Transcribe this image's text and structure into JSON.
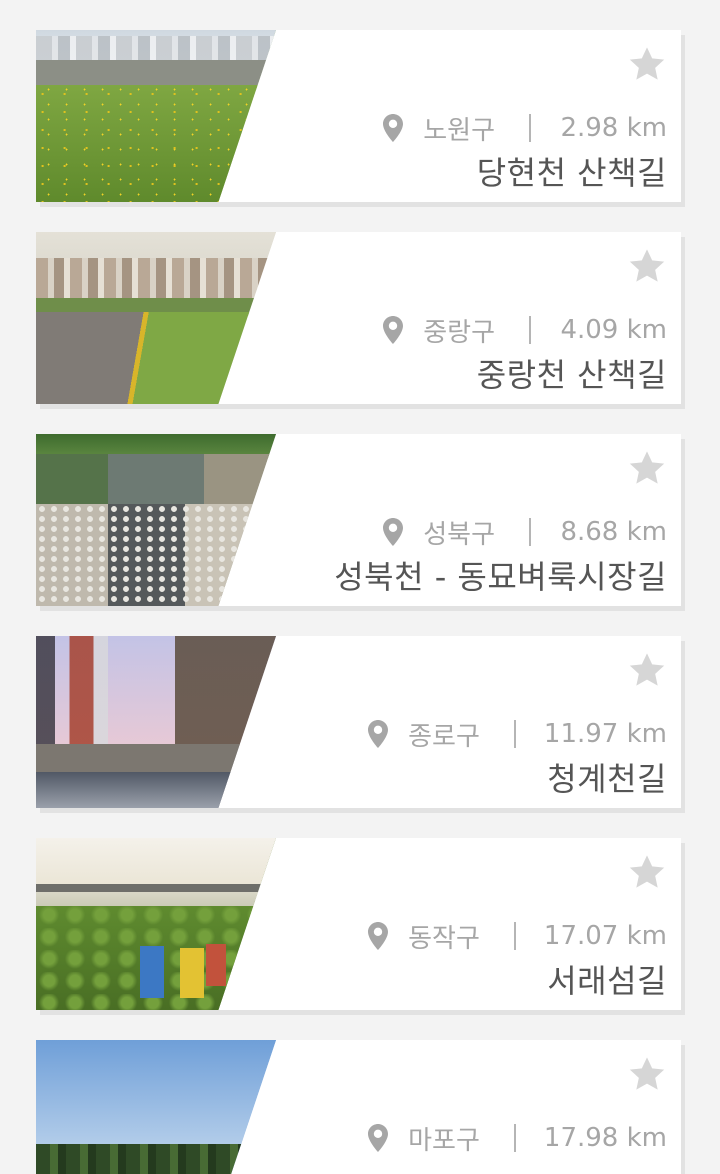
{
  "trails": [
    {
      "district": "노원구",
      "distance": "2.98 km",
      "name": "당현천 산책길",
      "photo": "yellow-flowers-stream"
    },
    {
      "district": "중랑구",
      "distance": "4.09 km",
      "name": "중랑천 산책길",
      "photo": "riverside-road"
    },
    {
      "district": "성북구",
      "distance": "8.68 km",
      "name": "성북천 - 동묘벼룩시장길",
      "photo": "stone-stream"
    },
    {
      "district": "종로구",
      "distance": "11.97 km",
      "name": "청계천길",
      "photo": "city-stream-fountain"
    },
    {
      "district": "동작구",
      "distance": "17.07 km",
      "name": "서래섬길",
      "photo": "bridge-chairs"
    },
    {
      "district": "마포구",
      "distance": "17.98 km",
      "name": "",
      "photo": "park-sky"
    }
  ],
  "icons": {
    "favorite": "star-icon",
    "location": "map-pin-icon"
  },
  "colors": {
    "card": "#ffffff",
    "background": "#f3f3f3",
    "meta_text": "#a6a6a6",
    "name_text": "#555555",
    "star": "#d6d6d6"
  }
}
